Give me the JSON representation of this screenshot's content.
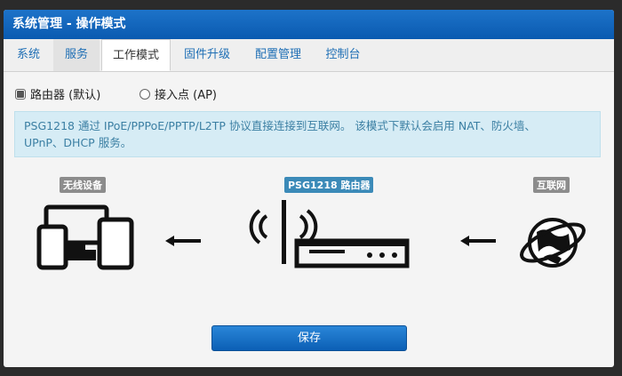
{
  "window": {
    "title": "系统管理 - 操作模式"
  },
  "tabs": [
    {
      "label": "系统"
    },
    {
      "label": "服务"
    },
    {
      "label": "工作模式"
    },
    {
      "label": "固件升级"
    },
    {
      "label": "配置管理"
    },
    {
      "label": "控制台"
    }
  ],
  "mode": {
    "options": [
      {
        "label": "路由器 (默认)",
        "selected": true
      },
      {
        "label": "接入点 (AP)",
        "selected": false
      }
    ]
  },
  "info": {
    "text_line1": "PSG1218 通过 IPoE/PPPoE/PPTP/L2TP 协议直接连接到互联网。 该模式下默认会启用 NAT、防火墙、",
    "text_line2": "UPnP、DHCP 服务。"
  },
  "diagram": {
    "devices_label": "无线设备",
    "router_label": "PSG1218 路由器",
    "internet_label": "互联网"
  },
  "actions": {
    "save_label": "保存"
  },
  "colors": {
    "accent": "#0b63b8",
    "info_bg": "#d6ecf5",
    "info_text": "#3b7fa3"
  }
}
